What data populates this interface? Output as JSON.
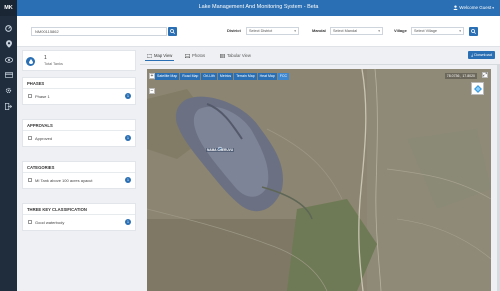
{
  "app": {
    "brand": "MK",
    "title": "Lake Management And Monitoring System - Beta",
    "user": "Welcome Guest"
  },
  "nav_icons": [
    "dashboard-icon",
    "location-pin-icon",
    "eye-icon",
    "card-icon",
    "settings-icon",
    "logout-icon"
  ],
  "search": {
    "value": "NM00115862"
  },
  "filters": {
    "district_label": "District",
    "district_value": "Select District",
    "mandal_label": "Mandal",
    "mandal_value": "Select Mandal",
    "village_label": "Village",
    "village_value": "Select Village"
  },
  "stats": {
    "count": "1",
    "label": "Total Tanks"
  },
  "panels": {
    "phases": {
      "title": "PHASES",
      "item": "Phase 1",
      "count": "1"
    },
    "approvals": {
      "title": "APPROVALS",
      "item": "Approved",
      "count": "1"
    },
    "categories": {
      "title": "CATEGORIES",
      "item": "MI Tank above 100 acres ayacut",
      "count": "1"
    },
    "three_key": {
      "title": "THREE KEY CLASSIFICATION",
      "item": "Good waterbody",
      "count": "1"
    }
  },
  "tabs": {
    "map": "Map View",
    "photos": "Photos",
    "tabular": "Tabular View"
  },
  "download_label": "Download",
  "map": {
    "tools": [
      "Satellite Map",
      "Road Map",
      "Ori-Lith",
      "Metrics",
      "Terrain Map",
      "Heat Map",
      "FCC"
    ],
    "coords": "78.0736 , 17.8020",
    "lake_label": "NAMA CHERUVU"
  },
  "colors": {
    "primary": "#2a6fb3",
    "sidebar": "#1f2d3d"
  }
}
